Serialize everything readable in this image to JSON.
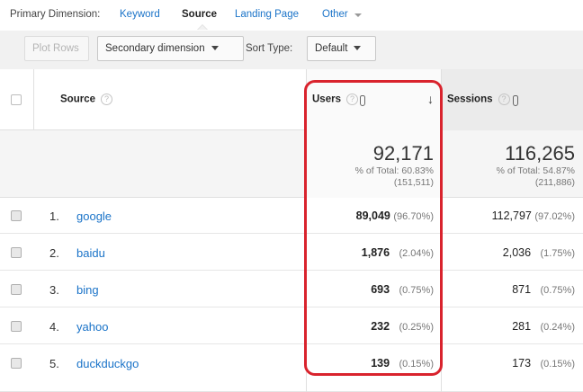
{
  "primary_dimension": {
    "label": "Primary Dimension:",
    "options": [
      {
        "label": "Keyword",
        "active": false
      },
      {
        "label": "Source",
        "active": true
      },
      {
        "label": "Landing Page",
        "active": false
      },
      {
        "label": "Other",
        "active": false
      }
    ]
  },
  "toolbar": {
    "plot_rows": "Plot Rows",
    "secondary_dimension": "Secondary dimension",
    "sort_type_label": "Sort Type:",
    "sort_type_value": "Default"
  },
  "table": {
    "headers": {
      "source": "Source",
      "users": "Users",
      "sessions": "Sessions",
      "help": "?",
      "sort_arrow": "↓"
    },
    "summary": {
      "users_total": "92,171",
      "users_pct_line": "% of Total: 60.83%",
      "users_of": "(151,511)",
      "sessions_total": "116,265",
      "sessions_pct_line": "% of Total: 54.87%",
      "sessions_of": "(211,886)"
    },
    "rows": [
      {
        "index": "1.",
        "source": "google",
        "users": "89,049",
        "users_pct": "(96.70%)",
        "sessions": "112,797",
        "sessions_pct": "(97.02%)"
      },
      {
        "index": "2.",
        "source": "baidu",
        "users": "1,876",
        "users_pct": "(2.04%)",
        "sessions": "2,036",
        "sessions_pct": "(1.75%)"
      },
      {
        "index": "3.",
        "source": "bing",
        "users": "693",
        "users_pct": "(0.75%)",
        "sessions": "871",
        "sessions_pct": "(0.75%)"
      },
      {
        "index": "4.",
        "source": "yahoo",
        "users": "232",
        "users_pct": "(0.25%)",
        "sessions": "281",
        "sessions_pct": "(0.24%)"
      },
      {
        "index": "5.",
        "source": "duckduckgo",
        "users": "139",
        "users_pct": "(0.15%)",
        "sessions": "173",
        "sessions_pct": "(0.15%)"
      }
    ]
  },
  "colors": {
    "link": "#1a73c8",
    "highlight": "#d9232d"
  }
}
